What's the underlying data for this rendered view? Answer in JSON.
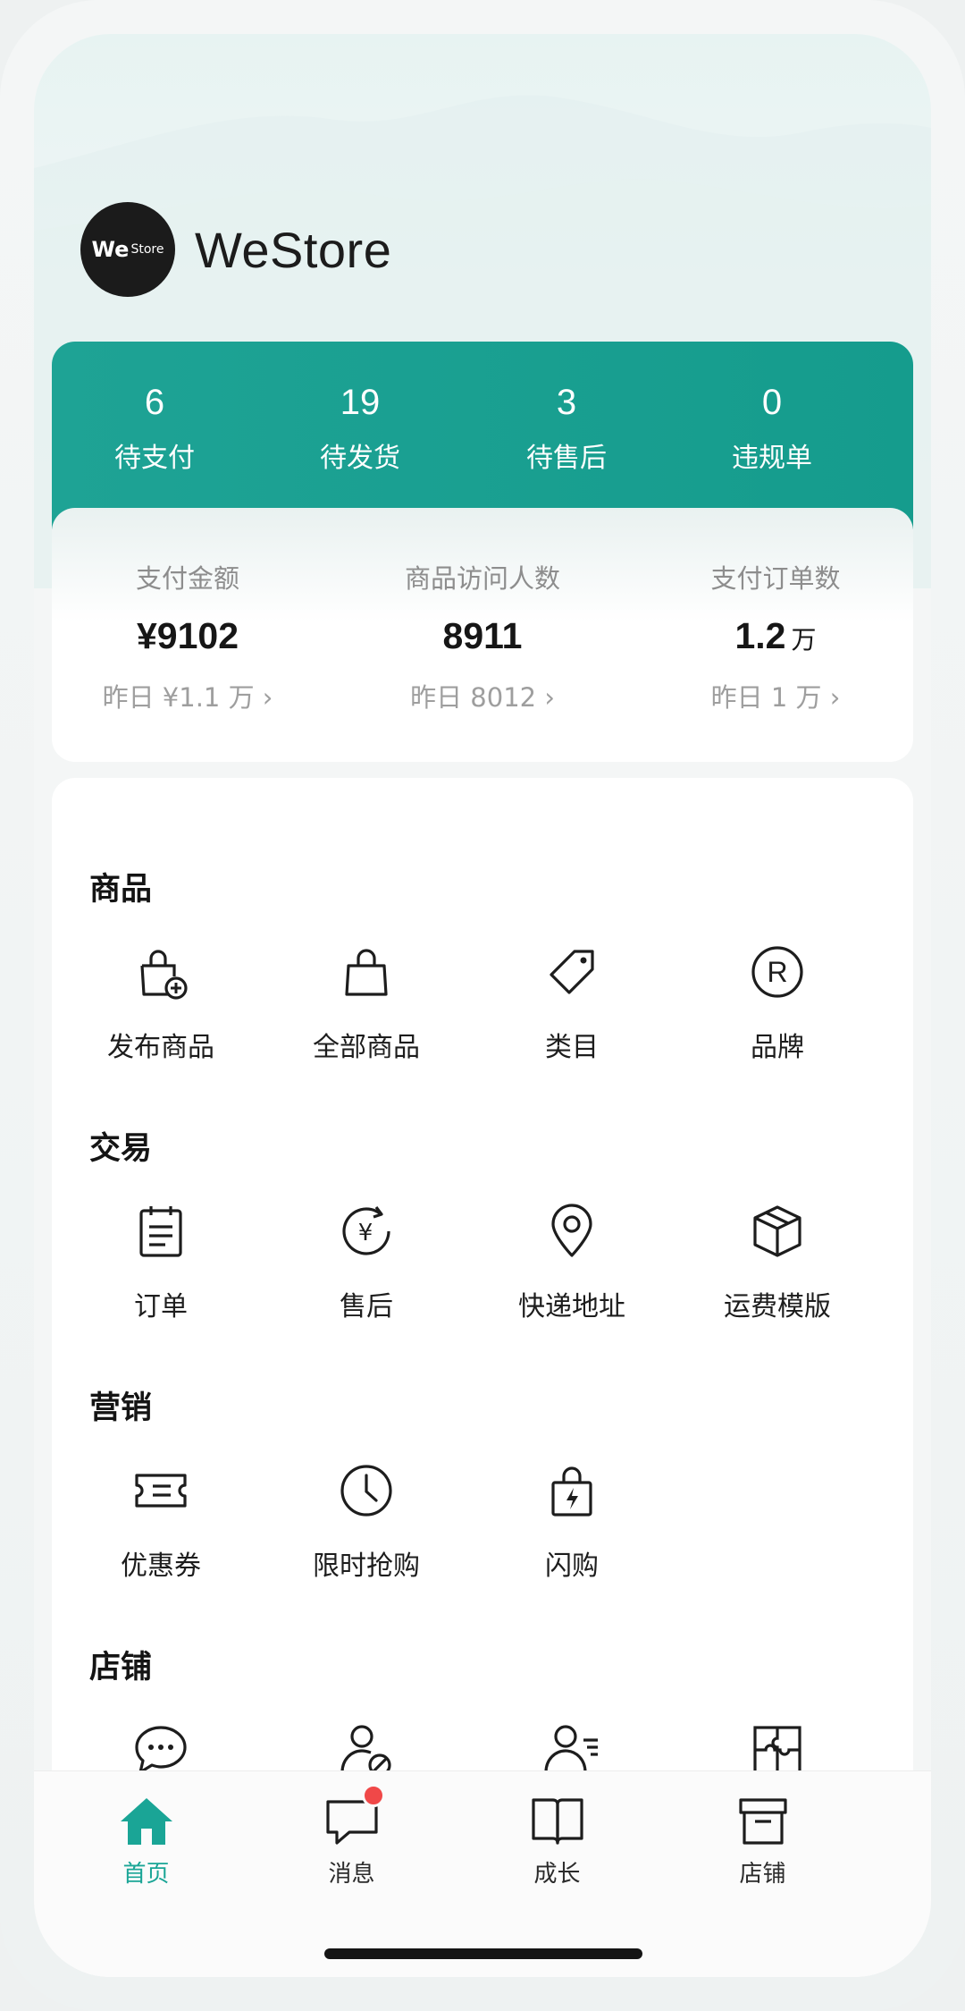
{
  "brand": {
    "name": "WeStore",
    "logo_we": "We",
    "logo_store": "Store"
  },
  "status_stats": [
    {
      "value": "6",
      "label": "待支付"
    },
    {
      "value": "19",
      "label": "待发货"
    },
    {
      "value": "3",
      "label": "待售后"
    },
    {
      "value": "0",
      "label": "违规单"
    }
  ],
  "metrics": [
    {
      "label": "支付金额",
      "value": "¥9102",
      "unit": "",
      "sub": "昨日 ¥1.1 万 ›"
    },
    {
      "label": "商品访问人数",
      "value": "8911",
      "unit": "",
      "sub": "昨日 8012 ›"
    },
    {
      "label": "支付订单数",
      "value": "1.2",
      "unit": "万",
      "sub": "昨日 1 万 ›"
    }
  ],
  "sections": {
    "goods": {
      "title": "商品",
      "items": [
        "发布商品",
        "全部商品",
        "类目",
        "品牌"
      ]
    },
    "trade": {
      "title": "交易",
      "items": [
        "订单",
        "售后",
        "快递地址",
        "运费模版"
      ]
    },
    "marketing": {
      "title": "营销",
      "items": [
        "优惠券",
        "限时抢购",
        "闪购"
      ]
    },
    "store": {
      "title": "店铺"
    }
  },
  "tabs": [
    {
      "label": "首页",
      "icon": "home-icon",
      "active": true
    },
    {
      "label": "消息",
      "icon": "message-icon",
      "badge": true
    },
    {
      "label": "成长",
      "icon": "book-icon"
    },
    {
      "label": "店铺",
      "icon": "store-icon"
    }
  ],
  "colors": {
    "accent": "#1aa596",
    "badge": "#f04848",
    "text": "#1d1d1d"
  }
}
